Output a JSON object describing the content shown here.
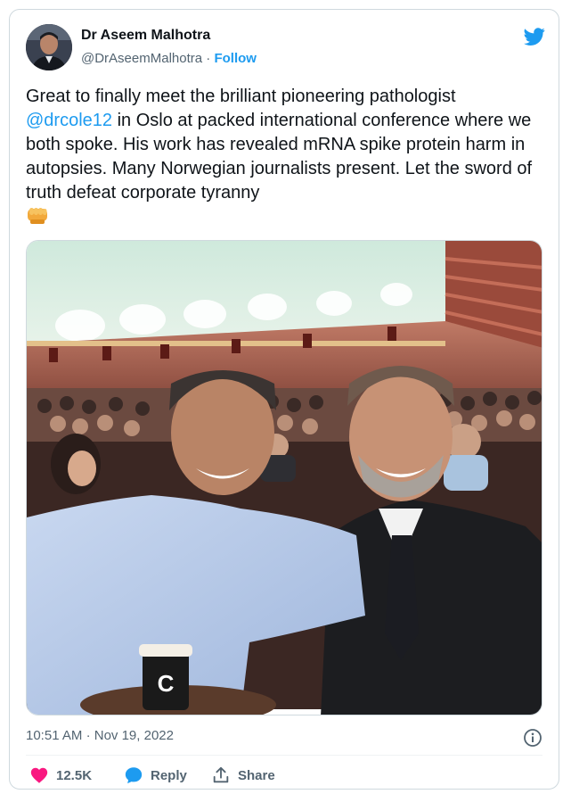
{
  "author": {
    "name": "Dr Aseem Malhotra",
    "handle": "@DrAseemMalhotra",
    "separator": "·",
    "follow_label": "Follow"
  },
  "tweet": {
    "text_before": "Great to finally meet the brilliant pioneering pathologist ",
    "mention": "@drcole12",
    "text_after": " in Oslo at packed international conference where we both spoke. His work has revealed mRNA spike protein harm in autopsies. Many Norwegian journalists present. Let the sword of truth defeat corporate tyranny",
    "emoji_icon": "oncoming-fist-icon"
  },
  "photo": {
    "cup_label": "C"
  },
  "meta": {
    "time": "10:51 AM",
    "date": "Nov 19, 2022",
    "separator": "·"
  },
  "actions": {
    "like_count": "12.5K",
    "reply_label": "Reply",
    "share_label": "Share"
  },
  "colors": {
    "accent": "#1d9bf0",
    "like": "#f91880",
    "muted": "#536471"
  }
}
